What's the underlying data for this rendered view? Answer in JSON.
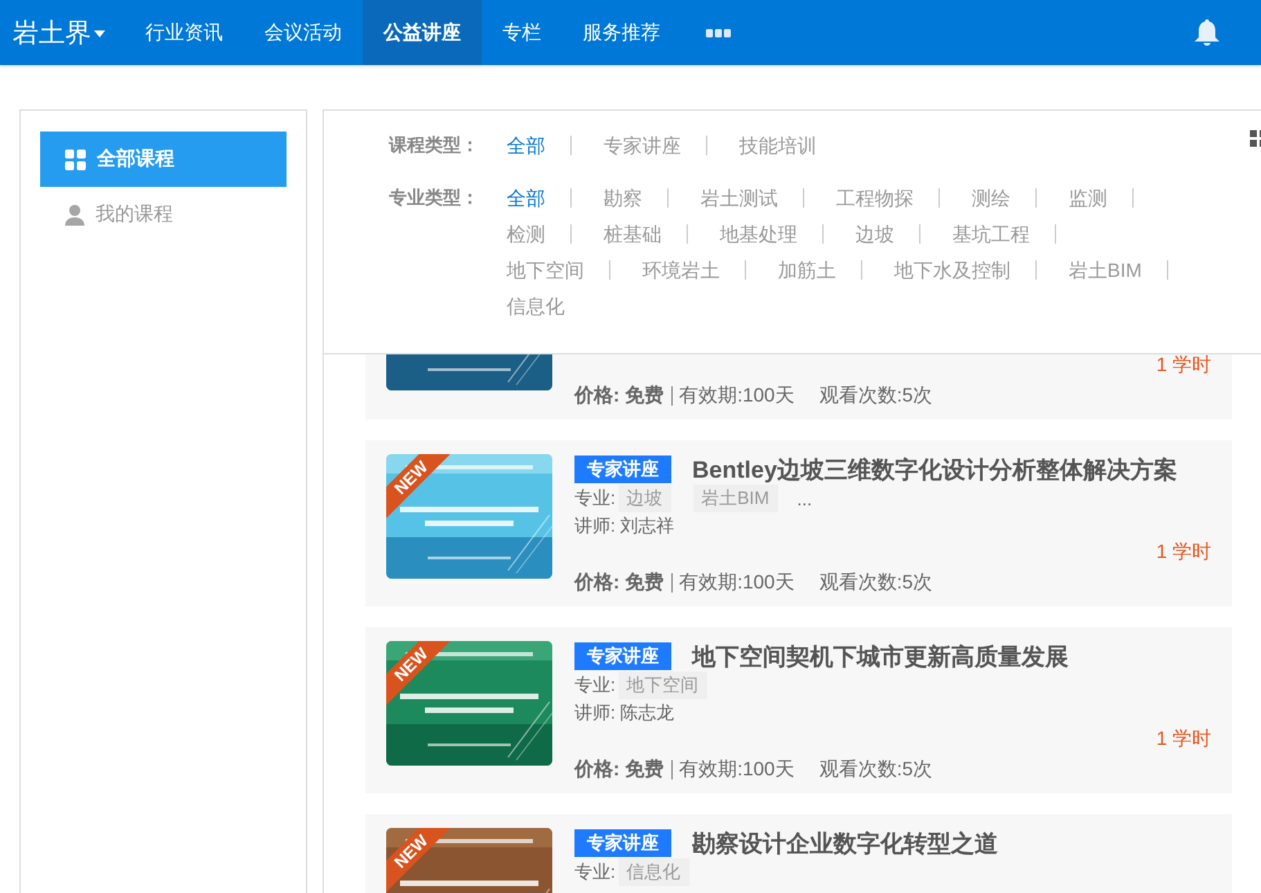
{
  "nav": {
    "logo": "岩土界",
    "items": [
      {
        "label": "行业资讯",
        "selected": false
      },
      {
        "label": "会议活动",
        "selected": false
      },
      {
        "label": "公益讲座",
        "selected": true
      },
      {
        "label": "专栏",
        "selected": false
      },
      {
        "label": "服务推荐",
        "selected": false
      }
    ]
  },
  "sidebar": {
    "items": [
      {
        "label": "全部课程",
        "selected": true,
        "kind": "grid"
      },
      {
        "label": "我的课程",
        "selected": false,
        "kind": "person"
      }
    ]
  },
  "filters": [
    {
      "label": "课程类型：",
      "options": [
        {
          "label": "全部",
          "selected": true
        },
        {
          "label": "专家讲座",
          "selected": false
        },
        {
          "label": "技能培训",
          "selected": false
        }
      ]
    },
    {
      "label": "专业类型：",
      "options": [
        {
          "label": "全部",
          "selected": true
        },
        {
          "label": "勘察",
          "selected": false
        },
        {
          "label": "岩土测试",
          "selected": false
        },
        {
          "label": "工程物探",
          "selected": false
        },
        {
          "label": "测绘",
          "selected": false
        },
        {
          "label": "监测",
          "selected": false
        },
        {
          "label": "检测",
          "selected": false
        },
        {
          "label": "桩基础",
          "selected": false
        },
        {
          "label": "地基处理",
          "selected": false
        },
        {
          "label": "边坡",
          "selected": false
        },
        {
          "label": "基坑工程",
          "selected": false
        },
        {
          "label": "地下空间",
          "selected": false
        },
        {
          "label": "环境岩土",
          "selected": false
        },
        {
          "label": "加筋土",
          "selected": false
        },
        {
          "label": "地下水及控制",
          "selected": false
        },
        {
          "label": "岩土BIM",
          "selected": false
        },
        {
          "label": "信息化",
          "selected": false
        }
      ]
    }
  ],
  "courses": [
    {
      "hours": "1 学时",
      "price": "价格: 免费",
      "validity": "有效期:100天",
      "views": "观看次数:5次"
    },
    {
      "badge": "NEW",
      "type": "专家讲座",
      "title": "Bentley边坡三维数字化设计分析整体解决方案",
      "major_label": "专业:",
      "majors": [
        "边坡",
        "岩土BIM"
      ],
      "more": "...",
      "lecturer": "讲师:  刘志祥",
      "hours": "1 学时",
      "price": "价格: 免费",
      "validity": "有效期:100天",
      "views": "观看次数:5次"
    },
    {
      "badge": "NEW",
      "type": "专家讲座",
      "title": "地下空间契机下城市更新高质量发展",
      "major_label": "专业:",
      "majors": [
        "地下空间"
      ],
      "lecturer": "讲师:  陈志龙",
      "hours": "1 学时",
      "price": "价格: 免费",
      "validity": "有效期:100天",
      "views": "观看次数:5次"
    },
    {
      "badge": "NEW",
      "type": "专家讲座",
      "title": "勘察设计企业数字化转型之道",
      "major_label": "专业:",
      "majors": [
        "信息化"
      ]
    }
  ]
}
